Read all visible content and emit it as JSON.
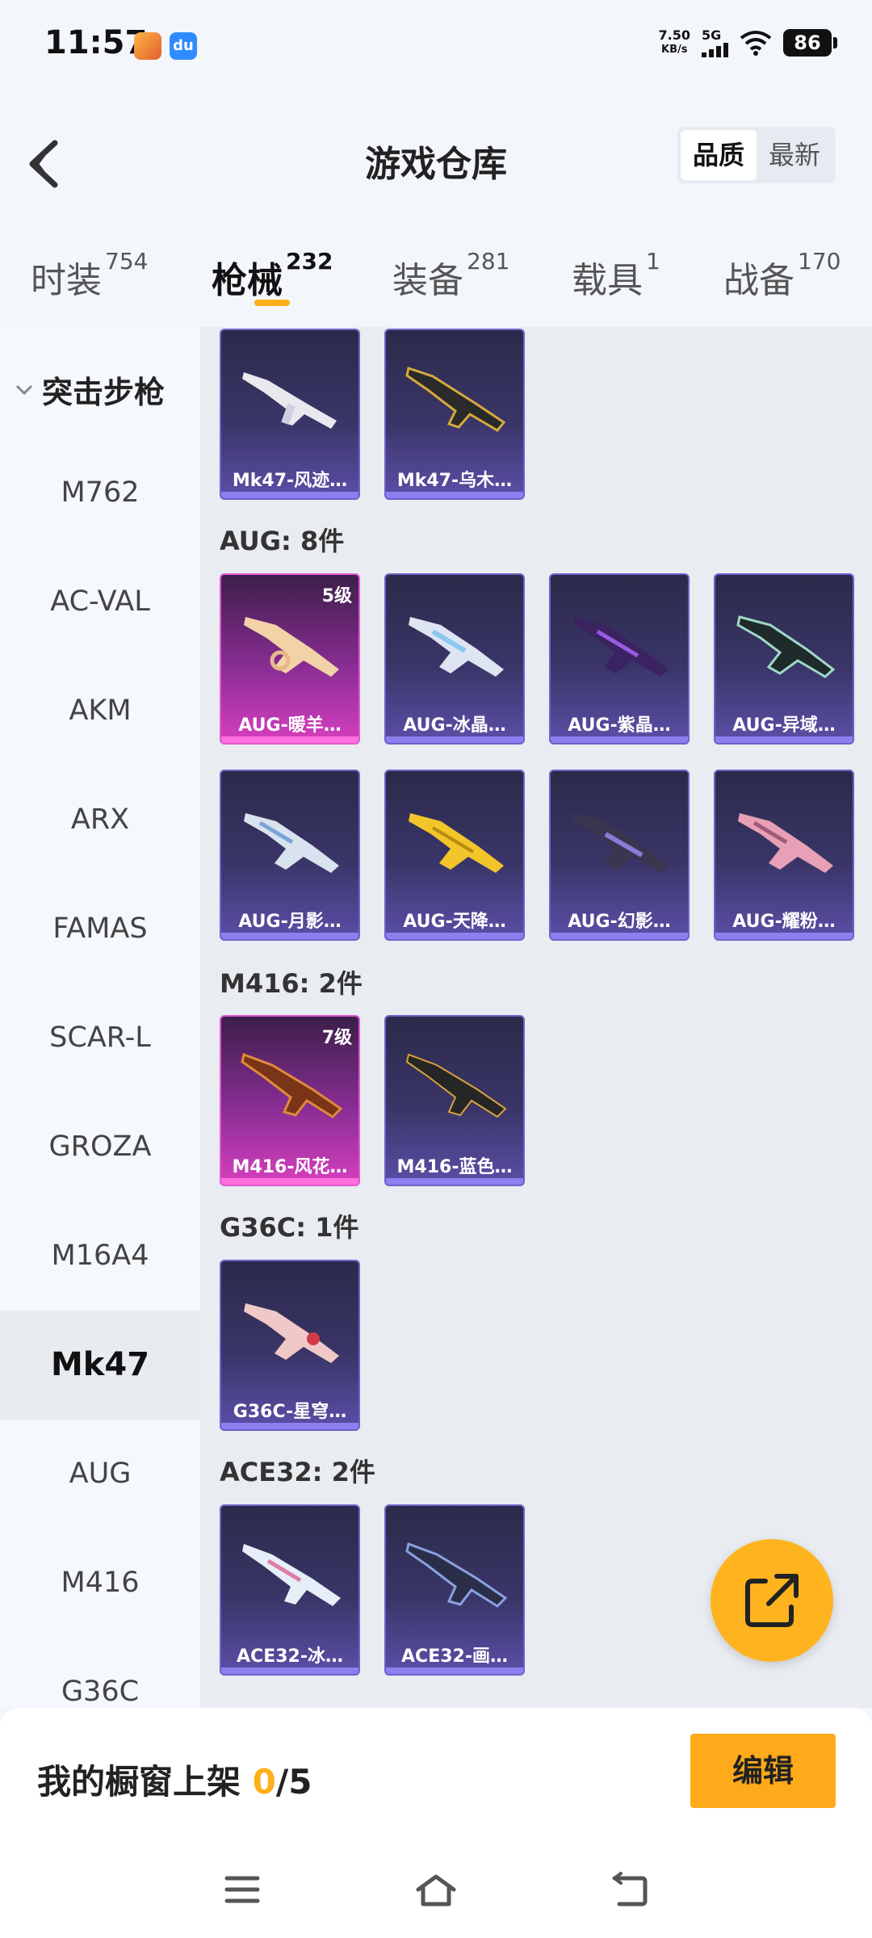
{
  "status_bar": {
    "time": "11:57",
    "net_speed_value": "7.50",
    "net_speed_unit": "KB/s",
    "network": "5G",
    "battery": "86",
    "app_icon_b": "du"
  },
  "header": {
    "title": "游戏仓库",
    "sort_options": [
      "品质",
      "最新"
    ],
    "sort_active": "品质"
  },
  "tabs": [
    {
      "label": "时装",
      "count": "754"
    },
    {
      "label": "枪械",
      "count": "232"
    },
    {
      "label": "装备",
      "count": "281"
    },
    {
      "label": "载具",
      "count": "1"
    },
    {
      "label": "战备",
      "count": "170"
    }
  ],
  "sidebar": {
    "group": "突击步枪",
    "items": [
      "M762",
      "AC-VAL",
      "AKM",
      "ARX",
      "FAMAS",
      "SCAR-L",
      "GROZA",
      "M16A4",
      "Mk47",
      "AUG",
      "M416",
      "G36C"
    ],
    "active": "Mk47"
  },
  "sections": {
    "mk47": {
      "cards": [
        {
          "label": "Mk47-风迹…"
        },
        {
          "label": "Mk47-乌木…"
        }
      ]
    },
    "aug": {
      "title": "AUG: 8件",
      "cards": [
        {
          "label": "AUG-暖羊…",
          "level": "5级"
        },
        {
          "label": "AUG-冰晶…"
        },
        {
          "label": "AUG-紫晶…"
        },
        {
          "label": "AUG-异域…"
        },
        {
          "label": "AUG-月影…"
        },
        {
          "label": "AUG-天降…"
        },
        {
          "label": "AUG-幻影…"
        },
        {
          "label": "AUG-耀粉…"
        }
      ]
    },
    "m416": {
      "title": "M416: 2件",
      "cards": [
        {
          "label": "M416-风花…",
          "level": "7级"
        },
        {
          "label": "M416-蓝色…"
        }
      ]
    },
    "g36c": {
      "title": "G36C: 1件",
      "cards": [
        {
          "label": "G36C-星穹…"
        }
      ]
    },
    "ace32": {
      "title": "ACE32: 2件",
      "cards": [
        {
          "label": "ACE32-冰…"
        },
        {
          "label": "ACE32-画…"
        }
      ]
    }
  },
  "showcase": {
    "prefix": "我的橱窗上架 ",
    "current": "0",
    "suffix": "/5",
    "edit_label": "编辑"
  },
  "colors": {
    "accent": "#ffae1a",
    "card_purple": "#3a3568",
    "card_pink": "#d63fbf"
  }
}
